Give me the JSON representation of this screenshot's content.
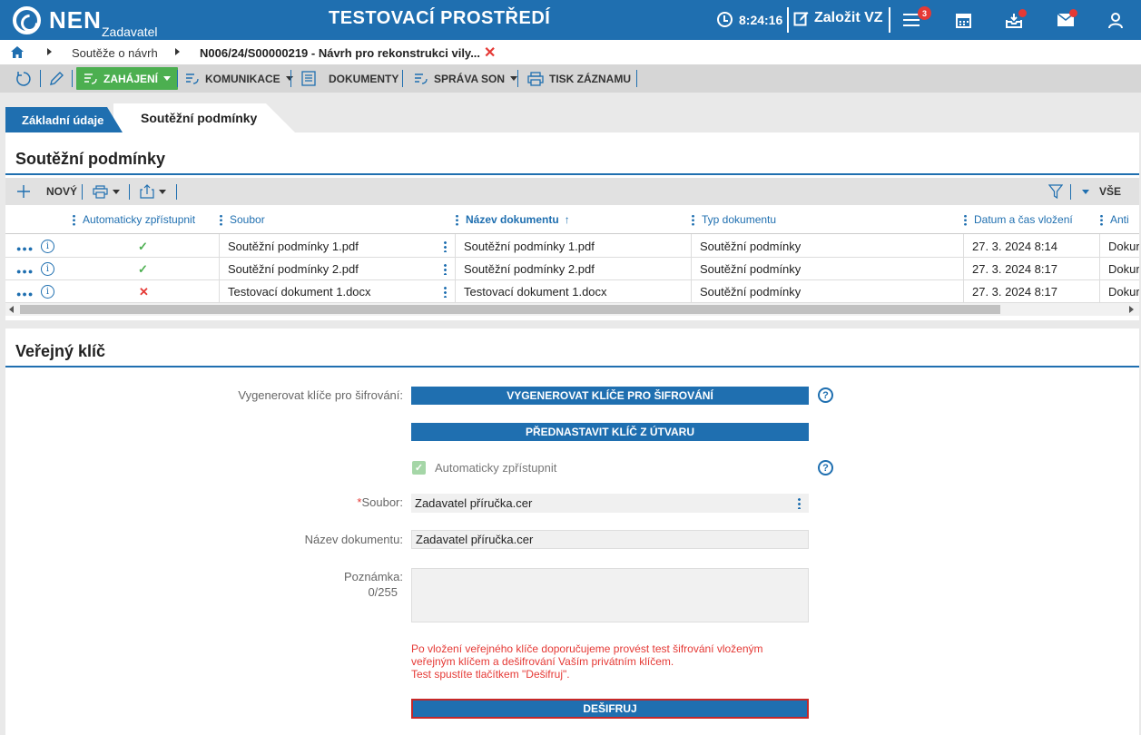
{
  "header": {
    "logo_text": "NEN",
    "logo_sub": "Zadavatel",
    "env_title": "TESTOVACÍ PROSTŘEDÍ",
    "clock": "8:24:16",
    "zalozit": "Založit VZ",
    "menu_badge": "3",
    "icons": [
      "clock-icon",
      "edit-icon",
      "menu-icon",
      "calendar-icon",
      "inbox-icon",
      "mail-icon",
      "user-icon"
    ]
  },
  "breadcrumb": {
    "item1": "Soutěže o návrh",
    "item2": "N006/24/S00000219 - Návrh pro rekonstrukci vily..."
  },
  "toolbar": {
    "zahajeni": "ZAHÁJENÍ",
    "komunikace": "KOMUNIKACE",
    "dokumenty": "DOKUMENTY",
    "sprava_son": "SPRÁVA SON",
    "tisk": "TISK ZÁZNAMU"
  },
  "tabs": {
    "tab1": "Základní údaje",
    "tab2": "Soutěžní podmínky"
  },
  "panel1": {
    "title": "Soutěžní podmínky",
    "novy": "NOVÝ",
    "vse": "VŠE",
    "columns": {
      "auto": "Automaticky zpřístupnit",
      "soubor": "Soubor",
      "nazev": "Název dokumentu",
      "typ": "Typ dokumentu",
      "datum": "Datum a čas vložení",
      "anti": "Anti"
    },
    "rows": [
      {
        "auto": "✓",
        "soubor": "Soutěžní podmínky 1.pdf",
        "nazev": "Soutěžní podmínky 1.pdf",
        "typ": "Soutěžní podmínky",
        "datum": "27. 3. 2024 8:14",
        "anti": "Dokur"
      },
      {
        "auto": "✓",
        "soubor": "Soutěžní podmínky 2.pdf",
        "nazev": "Soutěžní podmínky 2.pdf",
        "typ": "Soutěžní podmínky",
        "datum": "27. 3. 2024 8:17",
        "anti": "Dokur"
      },
      {
        "auto": "✕",
        "soubor": "Testovací dokument 1.docx",
        "nazev": "Testovací dokument 1.docx",
        "typ": "Soutěžní podmínky",
        "datum": "27. 3. 2024 8:17",
        "anti": "Dokur"
      }
    ]
  },
  "panel2": {
    "title": "Veřejný klíč",
    "label_generate": "Vygenerovat klíče pro šifrování:",
    "btn_generate": "VYGENEROVAT KLÍČE PRO ŠIFROVÁNÍ",
    "btn_preset": "PŘEDNASTAVIT KLÍČ Z ÚTVARU",
    "auto_label": "Automaticky zpřístupnit",
    "soubor_label": "Soubor:",
    "soubor_value": "Zadavatel příručka.cer",
    "nazev_label": "Název dokumentu:",
    "nazev_value": "Zadavatel příručka.cer",
    "poznamka_label": "Poznámka:",
    "poznamka_count": "0/255",
    "warning_line1": "Po vložení veřejného klíče doporučujeme provést test šifrování vloženým",
    "warning_line2": "veřejným klíčem a dešifrování Vaším privátním klíčem.",
    "warning_line3": "Test spustíte tlačítkem \"Dešifruj\".",
    "btn_desifruj": "DEŠIFRUJ"
  }
}
